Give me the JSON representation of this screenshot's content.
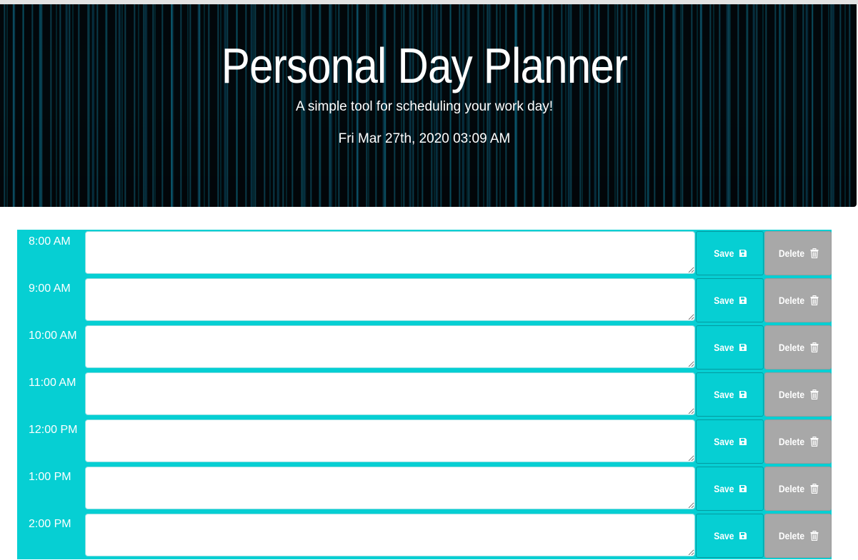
{
  "header": {
    "title": "Personal Day Planner",
    "subtitle": "A simple tool for scheduling your work day!",
    "datetime": "Fri Mar 27th, 2020 03:09 AM"
  },
  "planner": {
    "save_label": "Save",
    "delete_label": "Delete",
    "save_icon": "floppy-disk-icon",
    "delete_icon": "trash-icon",
    "rows": [
      {
        "hour": "8:00 AM",
        "text": ""
      },
      {
        "hour": "9:00 AM",
        "text": ""
      },
      {
        "hour": "10:00 AM",
        "text": ""
      },
      {
        "hour": "11:00 AM",
        "text": ""
      },
      {
        "hour": "12:00 PM",
        "text": ""
      },
      {
        "hour": "1:00 PM",
        "text": ""
      },
      {
        "hour": "2:00 PM",
        "text": ""
      }
    ]
  },
  "colors": {
    "accent": "#06cfd3",
    "delete": "#a8a8a8",
    "hero_background": "#02080c"
  }
}
